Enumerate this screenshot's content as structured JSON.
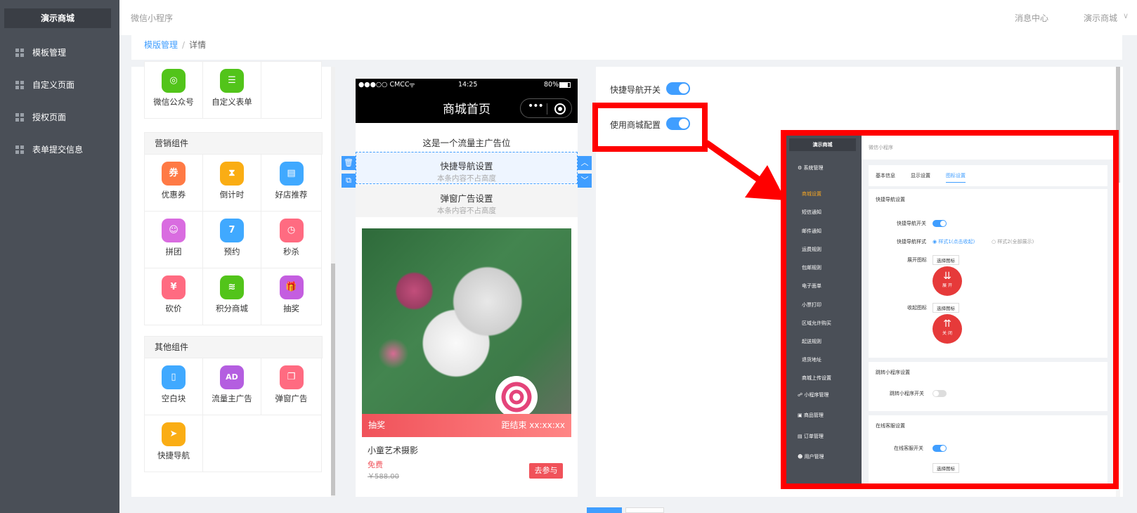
{
  "app": {
    "brand": "演示商城"
  },
  "sidebar": {
    "items": [
      {
        "label": "模板管理"
      },
      {
        "label": "自定义页面"
      },
      {
        "label": "授权页面"
      },
      {
        "label": "表单提交信息"
      }
    ]
  },
  "topbar": {
    "title": "微信小程序",
    "message_center": "消息中心",
    "user": "演示商城",
    "caret": "∨"
  },
  "breadcrumb": {
    "parent": "模版管理",
    "separator": "/",
    "current": "详情"
  },
  "components": {
    "top": [
      {
        "label": "微信公众号",
        "color": "#52c41a",
        "glyph": "◎"
      },
      {
        "label": "自定义表单",
        "color": "#52c41a",
        "glyph": "☰"
      }
    ],
    "marketing": {
      "title": "营销组件",
      "items": [
        {
          "label": "优惠券",
          "color": "#ff7a45",
          "glyph": "券"
        },
        {
          "label": "倒计时",
          "color": "#faad14",
          "glyph": "⧗"
        },
        {
          "label": "好店推荐",
          "color": "#40a9ff",
          "glyph": "▤"
        },
        {
          "label": "拼团",
          "color": "#d96ce0",
          "glyph": "☺"
        },
        {
          "label": "预约",
          "color": "#40a9ff",
          "glyph": "7"
        },
        {
          "label": "秒杀",
          "color": "#ff6b81",
          "glyph": "◷"
        },
        {
          "label": "砍价",
          "color": "#ff6b81",
          "glyph": "¥"
        },
        {
          "label": "积分商城",
          "color": "#52c41a",
          "glyph": "≋"
        },
        {
          "label": "抽奖",
          "color": "#c45ee0",
          "glyph": "🎁"
        }
      ]
    },
    "other": {
      "title": "其他组件",
      "items": [
        {
          "label": "空白块",
          "color": "#40a9ff",
          "glyph": "▯"
        },
        {
          "label": "流量主广告",
          "color": "#b45ee0",
          "glyph": "AD"
        },
        {
          "label": "弹窗广告",
          "color": "#ff6b81",
          "glyph": "❐"
        },
        {
          "label": "快捷导航",
          "color": "#faad14",
          "glyph": "➤"
        }
      ]
    }
  },
  "phone": {
    "carrier": "●●●○○ CMCC",
    "wifi": "ᯤ",
    "time": "14:25",
    "battery": "80%",
    "title": "商城首页",
    "capsule_dots": "•••",
    "ad_text": "这是一个流量主广告位",
    "sections": [
      {
        "title": "快捷导航设置",
        "subtitle": "本条内容不占高度"
      },
      {
        "title": "弹窗广告设置",
        "subtitle": "本条内容不占高度"
      }
    ],
    "controls": {
      "delete": "🗑",
      "copy": "⧉",
      "up": "︿",
      "down": "﹀"
    },
    "lottery": {
      "label": "抽奖",
      "countdown": "距结束 xx:xx:xx"
    },
    "product": {
      "name": "小童艺术摄影",
      "price": "免费",
      "original_price": "￥588.00",
      "button": "去参与"
    }
  },
  "settings": {
    "quick_nav_switch": {
      "label": "快捷导航开关",
      "on": true
    },
    "use_mall_config": {
      "label": "使用商城配置",
      "on": true
    }
  },
  "inset": {
    "brand": "演示商城",
    "topbar": "微信小程序",
    "menu": [
      {
        "label": "系统管理",
        "icon": "⚙"
      },
      {
        "label": "小程序管理",
        "icon": "☍"
      },
      {
        "label": "商品管理",
        "icon": "▣"
      },
      {
        "label": "订单管理",
        "icon": "▤"
      },
      {
        "label": "用户管理",
        "icon": "☻"
      }
    ],
    "submenu": [
      "商城设置",
      "短信通知",
      "邮件通知",
      "运费规则",
      "包邮规则",
      "电子面单",
      "小票打印",
      "区域允许购买",
      "起送规则",
      "退货地址",
      "商城上传设置"
    ],
    "tabs": [
      "基本信息",
      "显示设置",
      "图标设置"
    ],
    "quick_nav": {
      "title": "快捷导航设置",
      "switch_label": "快捷导航开关",
      "style_label": "快捷导航样式",
      "style1": "样式1(点击收起)",
      "style2": "样式2(全部展示)",
      "expand_label": "展开图标",
      "collapse_label": "收起图标",
      "choose": "选择图标",
      "expand_text": "展 开",
      "collapse_text": "关 闭"
    },
    "jump": {
      "title": "跳转小程序设置",
      "switch_label": "跳转小程序开关"
    },
    "online": {
      "title": "在线客服设置",
      "switch_label": "在线客服开关",
      "choose": "选择图标"
    }
  },
  "colors": {
    "accent": "#409eff",
    "sidebar": "#4a4f57",
    "annotation": "#ff0000",
    "lottery": "#f0525a"
  }
}
